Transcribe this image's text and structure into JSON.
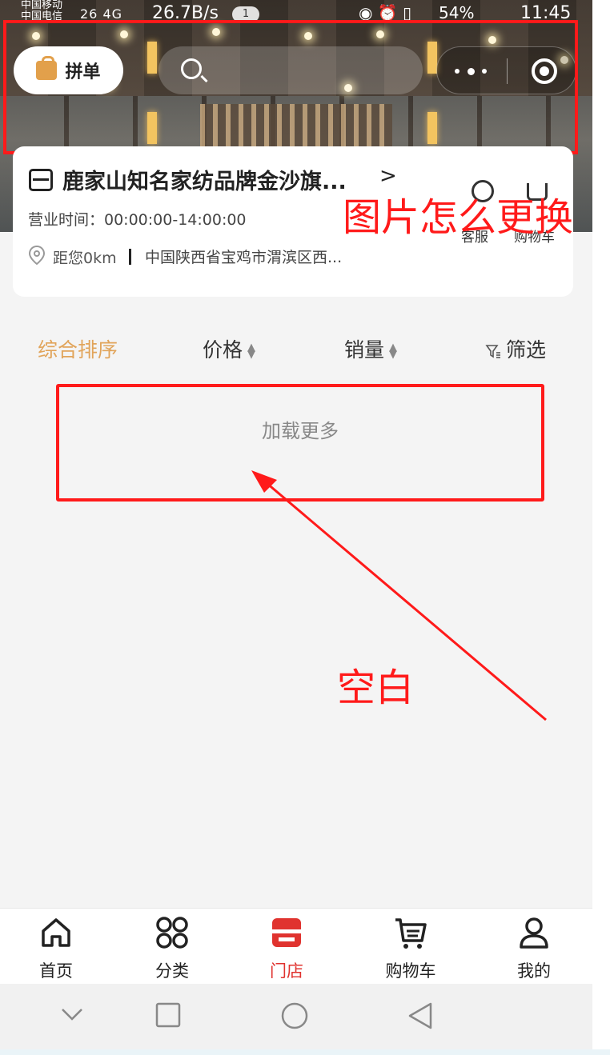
{
  "status_bar": {
    "carrier1": "中国移动",
    "carrier2": "中国电信",
    "signal": "26 4G",
    "net_speed": "26.7B/s",
    "notification_count": "1",
    "battery": "54%",
    "time": "11:45"
  },
  "header": {
    "pindan_label": "拼单"
  },
  "store": {
    "name": "鹿家山知名家纺品牌金沙旗...",
    "hours": "营业时间：00:00:00-14:00:00",
    "distance": "距您0km",
    "address": "中国陕西省宝鸡市渭滨区西...",
    "customer_service_label": "客服",
    "cart_label": "购物车"
  },
  "annotations": {
    "image_question": "图片怎么更换",
    "blank": "空白",
    "color": "#ff1a1a"
  },
  "sort_bar": {
    "comprehensive": "综合排序",
    "price": "价格",
    "sales": "销量",
    "filter": "筛选",
    "active_color": "#e1a45a"
  },
  "load_more": "加载更多",
  "tabbar": {
    "home": "首页",
    "category": "分类",
    "store": "门店",
    "cart": "购物车",
    "mine": "我的",
    "active_color": "#e0332f"
  }
}
